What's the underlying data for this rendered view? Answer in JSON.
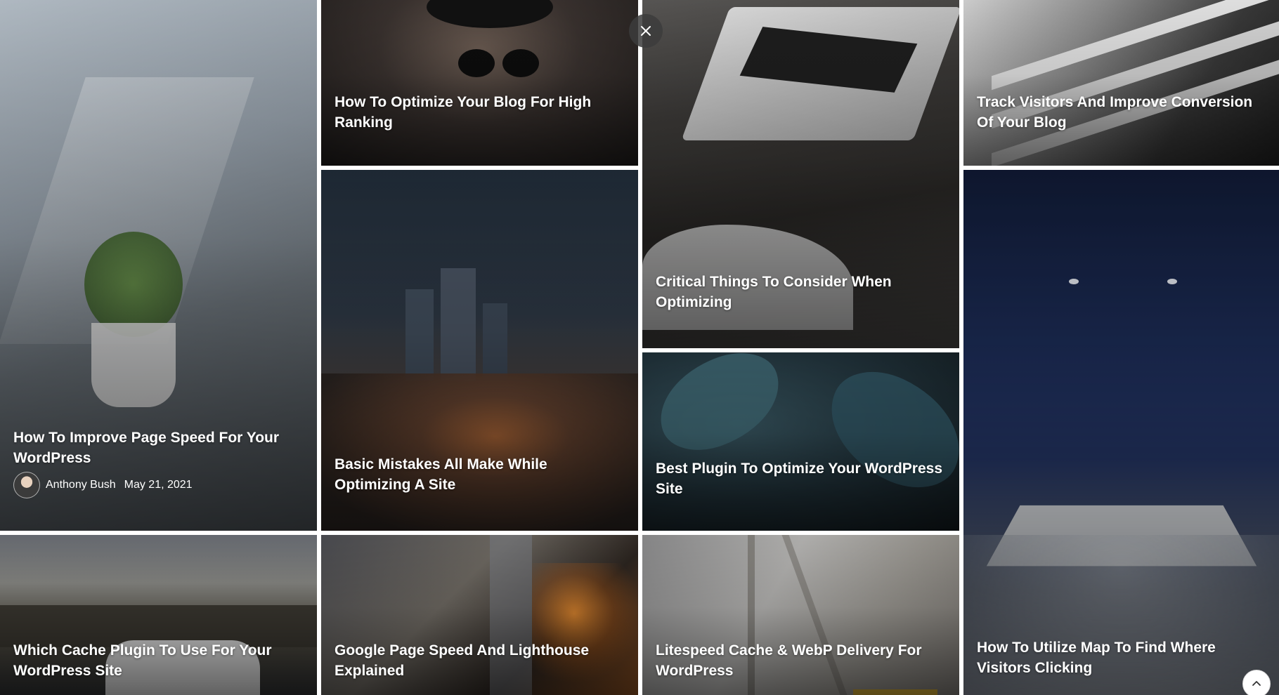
{
  "posts": [
    {
      "title": "How To Improve Page Speed For Your WordPress",
      "author": "Anthony Bush",
      "date": "May 21, 2021"
    },
    {
      "title": "How To Optimize Your Blog For High Ranking"
    },
    {
      "title": "Critical Things To Consider When Optimizing"
    },
    {
      "title": "Track Visitors And Improve Conversion Of Your Blog"
    },
    {
      "title": "Basic Mistakes All Make While Optimizing A Site"
    },
    {
      "title": "Best Plugin To Optimize Your WordPress Site"
    },
    {
      "title": "How To Utilize Map To Find Where Visitors Clicking"
    },
    {
      "title": "Which Cache Plugin To Use For Your WordPress Site"
    },
    {
      "title": "Google Page Speed And Lighthouse Explained"
    },
    {
      "title": "Litespeed Cache & WebP Delivery For WordPress"
    }
  ],
  "controls": {
    "close_icon": "close-icon",
    "scroll_top_icon": "chevron-up-icon"
  },
  "colors": {
    "title_text": "#ffffff",
    "close_button_bg": "#3c3c3c",
    "scroll_top_bg": "#ffffff"
  }
}
